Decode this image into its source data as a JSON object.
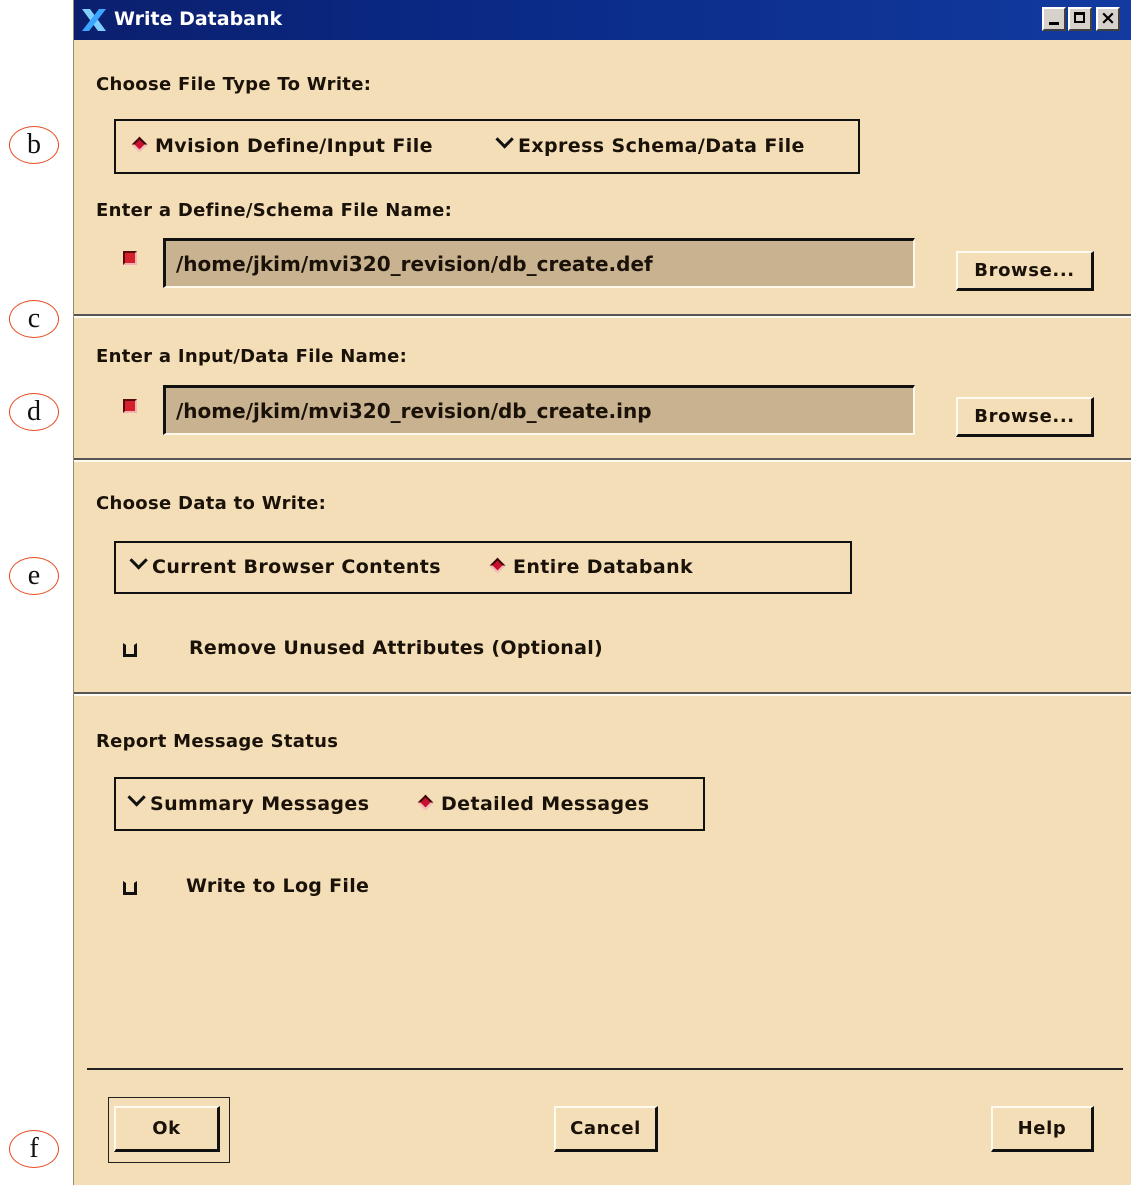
{
  "window": {
    "title": "Write Databank",
    "controls": {
      "minimize": "_",
      "maximize": "□",
      "close": "×"
    }
  },
  "callouts": [
    "b",
    "c",
    "d",
    "e",
    "f"
  ],
  "file_type": {
    "label": "Choose File Type To Write:",
    "options": [
      {
        "label": "Mvision Define/Input File",
        "selected": true
      },
      {
        "label": "Express Schema/Data File",
        "selected": false
      }
    ]
  },
  "define_file": {
    "label": "Enter a Define/Schema File Name:",
    "enabled": true,
    "value": "/home/jkim/mvi320_revision/db_create.def",
    "browse_label": "Browse..."
  },
  "input_file": {
    "label": "Enter a Input/Data File Name:",
    "enabled": true,
    "value": "/home/jkim/mvi320_revision/db_create.inp",
    "browse_label": "Browse..."
  },
  "data_choice": {
    "label": "Choose Data to Write:",
    "options": [
      {
        "label": "Current Browser Contents",
        "selected": false
      },
      {
        "label": "Entire Databank",
        "selected": true
      }
    ],
    "remove_unused": {
      "label": "Remove Unused Attributes (Optional)",
      "checked": false
    }
  },
  "report": {
    "label": "Report Message Status",
    "options": [
      {
        "label": "Summary Messages",
        "selected": false
      },
      {
        "label": "Detailed Messages",
        "selected": true
      }
    ],
    "log_file": {
      "label": "Write to Log File",
      "checked": false
    }
  },
  "buttons": {
    "ok": "Ok",
    "cancel": "Cancel",
    "help": "Help"
  },
  "colors": {
    "panel": "#f3deb7",
    "titlebar": "#0b1f6e",
    "accent_red": "#c8102e",
    "field": "#c9b290"
  }
}
